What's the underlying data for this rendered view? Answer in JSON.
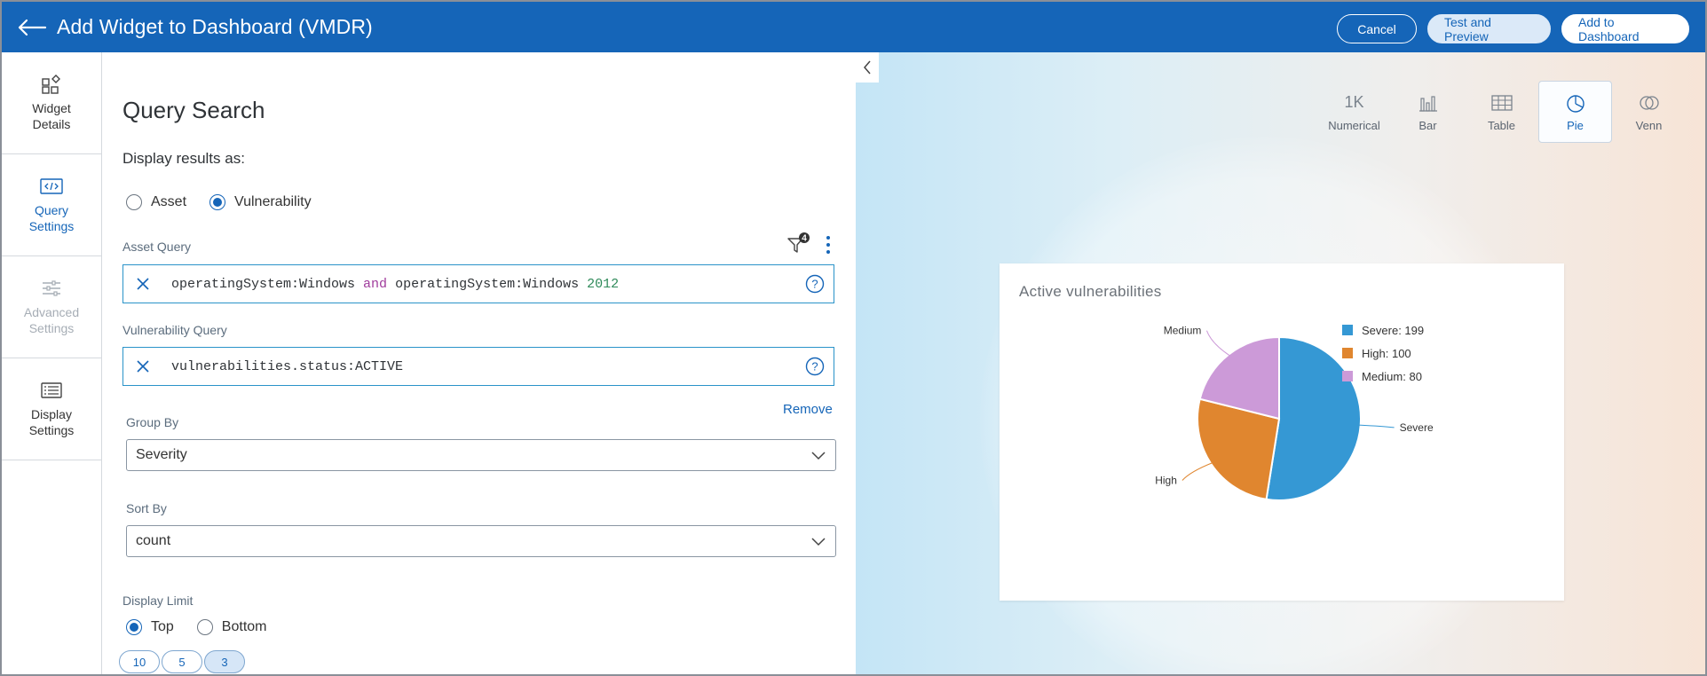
{
  "header": {
    "title": "Add Widget to Dashboard (VMDR)",
    "cancel": "Cancel",
    "test_preview": "Test and Preview",
    "add_to_dashboard": "Add to Dashboard",
    "color": "#1565b8"
  },
  "sidebar": {
    "items": [
      {
        "label": "Widget Details",
        "icon": "widget-shapes-icon",
        "state": "normal"
      },
      {
        "label": "Query Settings",
        "icon": "code-icon",
        "state": "active"
      },
      {
        "label": "Advanced Settings",
        "icon": "sliders-icon",
        "state": "disabled"
      },
      {
        "label": "Display Settings",
        "icon": "display-list-icon",
        "state": "normal"
      }
    ]
  },
  "query": {
    "heading": "Query Search",
    "display_as_label": "Display results as:",
    "display_options": [
      "Asset",
      "Vulnerability"
    ],
    "display_selected": "Vulnerability",
    "asset_query_label": "Asset Query",
    "filter_count": "4",
    "asset_query": {
      "part1": "operatingSystem:Windows ",
      "kw": "and",
      "part2": " operatingSystem:Windows ",
      "num": "2012"
    },
    "vuln_query_label": "Vulnerability Query",
    "vuln_query": "vulnerabilities.status:ACTIVE",
    "remove": "Remove",
    "group_by_label": "Group By",
    "group_by": "Severity",
    "sort_by_label": "Sort By",
    "sort_by": "count",
    "display_limit_label": "Display Limit",
    "limit_options": [
      "Top",
      "Bottom"
    ],
    "limit_selected": "Top",
    "count_pills": [
      "10",
      "5",
      "3"
    ],
    "count_selected": "3"
  },
  "preview": {
    "types": [
      {
        "label": "Numerical",
        "glyph": "1K"
      },
      {
        "label": "Bar",
        "glyph": ""
      },
      {
        "label": "Table",
        "glyph": ""
      },
      {
        "label": "Pie",
        "glyph": ""
      },
      {
        "label": "Venn",
        "glyph": ""
      }
    ],
    "active_type": "Pie"
  },
  "chart_data": {
    "type": "pie",
    "title": "Active vulnerabilities",
    "categories": [
      "Severe",
      "High",
      "Medium"
    ],
    "values": [
      199,
      100,
      80
    ],
    "legend": [
      "Severe: 199",
      "High: 100",
      "Medium: 80"
    ],
    "colors": [
      "#3598d4",
      "#e0862f",
      "#cc9ad8"
    ],
    "legend_placement": "top-right"
  }
}
